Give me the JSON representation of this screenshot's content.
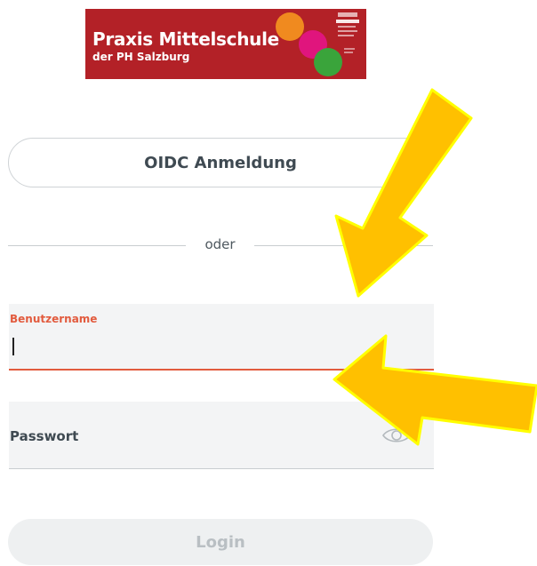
{
  "logo": {
    "title": "Praxis Mittelschule",
    "subtitle": "der PH Salzburg",
    "colors": {
      "banner": "#b32127",
      "orange": "#f08a1f",
      "pink": "#e0157d",
      "green": "#3aa43b"
    }
  },
  "oidc_button": {
    "label": "OIDC Anmeldung"
  },
  "divider": {
    "text": "oder"
  },
  "username_field": {
    "label": "Benutzername",
    "value": ""
  },
  "password_field": {
    "placeholder": "Passwort",
    "value": ""
  },
  "login_button": {
    "label": "Login",
    "enabled": false
  },
  "colors": {
    "accent": "#e25b3e",
    "annotation_arrow": "#ffc000",
    "annotation_outline": "#ffff00"
  },
  "icons": {
    "password_toggle": "eye-icon"
  }
}
